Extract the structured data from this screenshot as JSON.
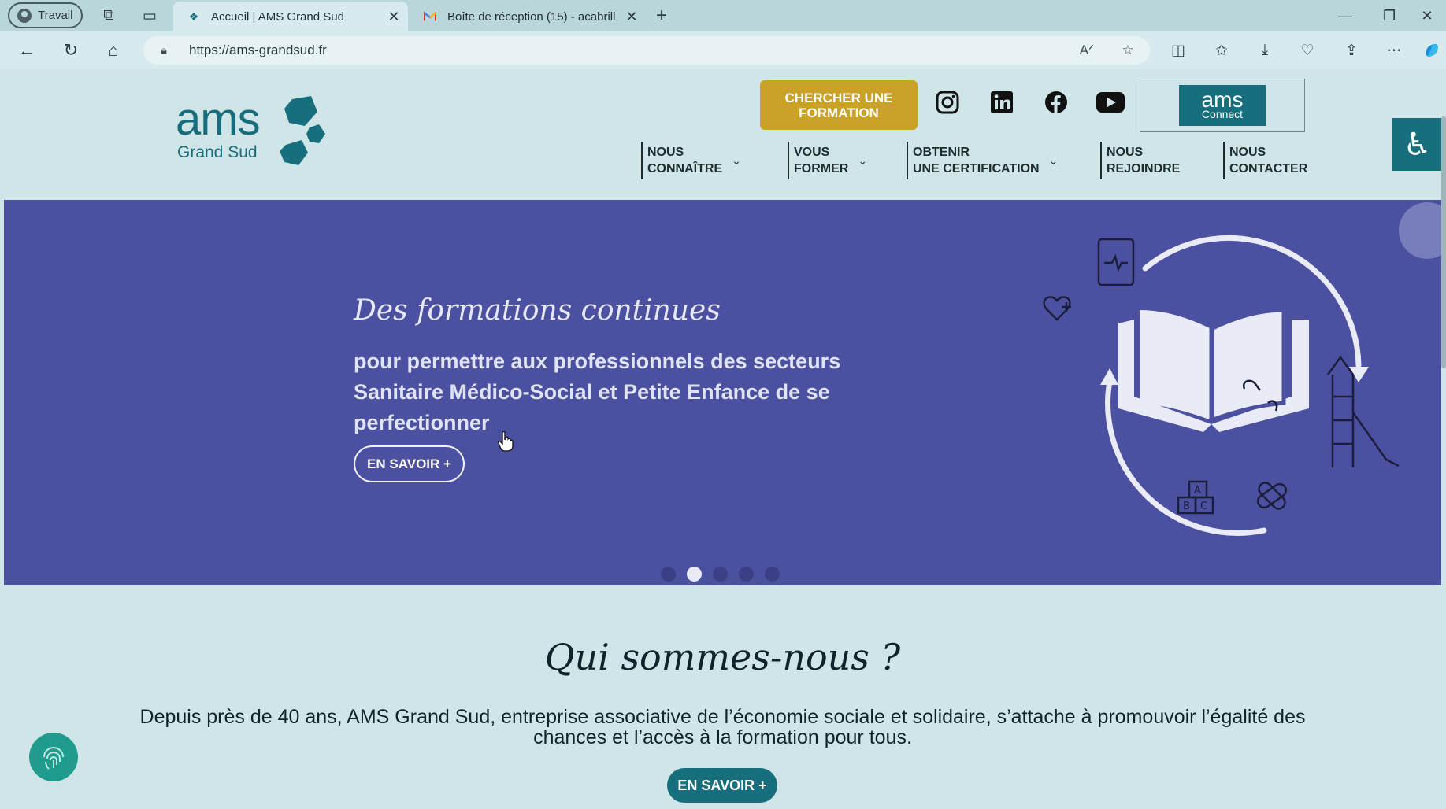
{
  "browser": {
    "profile_label": "Travail",
    "tabs": [
      {
        "title": "Accueil | AMS Grand Sud",
        "active": true
      },
      {
        "title": "Boîte de réception (15) - acabrill",
        "active": false
      }
    ],
    "address": "https://ams-grandsud.fr"
  },
  "site": {
    "logo_main": "ams",
    "logo_sub": "Grand Sud",
    "cta_search": "CHERCHER UNE FORMATION",
    "connect_main": "ams",
    "connect_sub": "Connect",
    "menu": [
      {
        "label": "NOUS\nCONNAÎTRE",
        "has_dropdown": true
      },
      {
        "label": "VOUS\nFORMER",
        "has_dropdown": true
      },
      {
        "label": "OBTENIR\nUNE CERTIFICATION",
        "has_dropdown": true
      },
      {
        "label": "NOUS\nREJOINDRE",
        "has_dropdown": false
      },
      {
        "label": "NOUS\nCONTACTER",
        "has_dropdown": false
      }
    ],
    "social": [
      "instagram-icon",
      "linkedin-icon",
      "facebook-icon",
      "youtube-icon"
    ]
  },
  "hero": {
    "script_title": "Des formations continues",
    "body": "pour permettre aux professionnels des secteurs Sanitaire Médico-Social et Petite Enfance de se perfectionner",
    "button": "EN SAVOIR +",
    "slides": 5,
    "active_slide": 2
  },
  "about": {
    "title": "Qui sommes-nous ?",
    "text": "Depuis près de 40 ans, AMS Grand Sud, entreprise associative de l’économie sociale et solidaire, s’attache à promouvoir l’égalité des chances et l’accès à la formation pour tous.",
    "button": "EN SAVOIR +"
  },
  "colors": {
    "brand_teal": "#176e7d",
    "hero_bg": "#4b51a0",
    "cta_gold": "#c9a227",
    "page_bg": "#cfe5e8"
  }
}
